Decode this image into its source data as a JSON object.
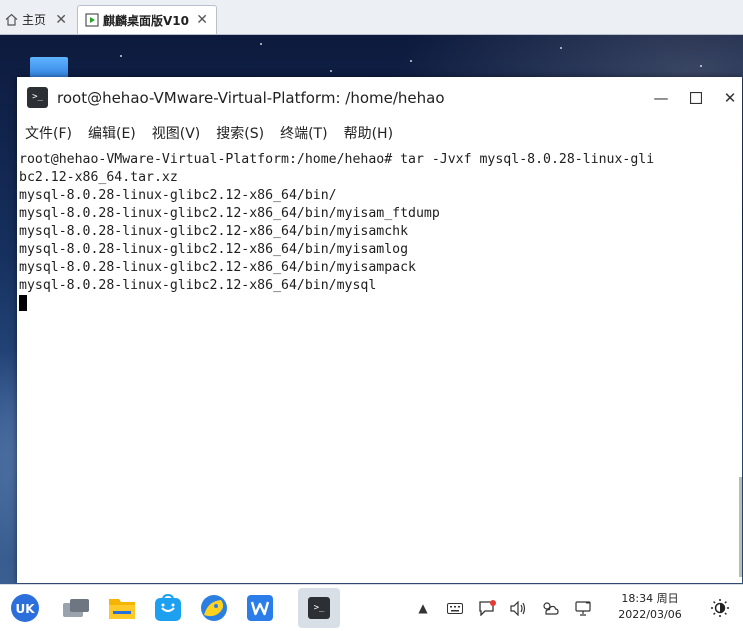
{
  "host_tabs": [
    {
      "label": "主页",
      "icon": "home-icon"
    },
    {
      "label": "麒麟桌面版V10",
      "icon": "vm-icon"
    }
  ],
  "window": {
    "title": "root@hehao-VMware-Virtual-Platform: /home/hehao",
    "controls": [
      "minimize-icon",
      "maximize-icon",
      "close-icon"
    ]
  },
  "menu": [
    "文件(F)",
    "编辑(E)",
    "视图(V)",
    "搜索(S)",
    "终端(T)",
    "帮助(H)"
  ],
  "terminal": {
    "lines": [
      "root@hehao-VMware-Virtual-Platform:/home/hehao# tar -Jvxf mysql-8.0.28-linux-gli",
      "bc2.12-x86_64.tar.xz",
      "mysql-8.0.28-linux-glibc2.12-x86_64/bin/",
      "mysql-8.0.28-linux-glibc2.12-x86_64/bin/myisam_ftdump",
      "mysql-8.0.28-linux-glibc2.12-x86_64/bin/myisamchk",
      "mysql-8.0.28-linux-glibc2.12-x86_64/bin/myisamlog",
      "mysql-8.0.28-linux-glibc2.12-x86_64/bin/myisampack",
      "mysql-8.0.28-linux-glibc2.12-x86_64/bin/mysql"
    ]
  },
  "taskbar": {
    "apps": [
      "start-menu-icon",
      "multitask-view-icon",
      "file-manager-icon",
      "software-store-icon",
      "browser-icon",
      "wps-icon",
      "terminal-icon"
    ],
    "time": "18:34 周日",
    "date": "2022/03/06"
  },
  "colors": {
    "accent": "#2f80e0",
    "terminal_text": "#1e1e1e"
  }
}
